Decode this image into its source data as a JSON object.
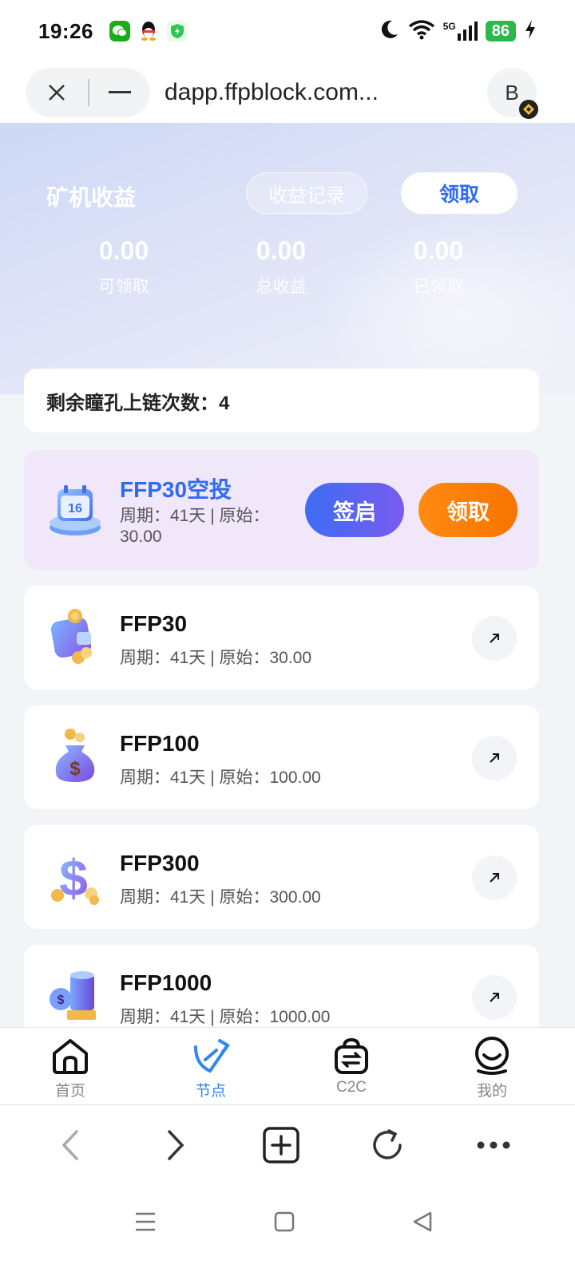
{
  "status_bar": {
    "time": "19:26",
    "network": "5G",
    "battery": "86",
    "icons": [
      "wechat-icon",
      "qq-icon",
      "shield-icon",
      "moon-icon",
      "wifi-icon",
      "signal-icon",
      "charging-icon"
    ]
  },
  "browser": {
    "url": "dapp.ffpblock.com...",
    "profile_initial": "B"
  },
  "hero": {
    "title": "矿机收益",
    "records_label": "收益记录",
    "claim_label": "领取",
    "stats": [
      {
        "value": "0.00",
        "label": "可领取"
      },
      {
        "value": "0.00",
        "label": "总收益"
      },
      {
        "value": "0.00",
        "label": "已领取"
      }
    ]
  },
  "remaining": {
    "text": "剩余瞳孔上链次数：4"
  },
  "airdrop": {
    "title": "FFP30空投",
    "desc": "周期：41天 | 原始：30.00",
    "sign_label": "签启",
    "claim_label": "领取"
  },
  "nodes": [
    {
      "name": "FFP30",
      "desc": "周期：41天 | 原始：30.00"
    },
    {
      "name": "FFP100",
      "desc": "周期：41天 | 原始：100.00"
    },
    {
      "name": "FFP300",
      "desc": "周期：41天 | 原始：300.00"
    },
    {
      "name": "FFP1000",
      "desc": "周期：41天 | 原始：1000.00"
    }
  ],
  "bottom_nav": [
    {
      "label": "首页",
      "icon": "home-icon"
    },
    {
      "label": "节点",
      "icon": "node-icon",
      "active": true
    },
    {
      "label": "C2C",
      "icon": "c2c-bag-icon"
    },
    {
      "label": "我的",
      "icon": "profile-icon"
    }
  ],
  "colors": {
    "accent_blue": "#2f6cf3",
    "nav_active": "#2f87f0",
    "orange": "#f77400",
    "airdrop_bg": "#f1e7fb"
  }
}
